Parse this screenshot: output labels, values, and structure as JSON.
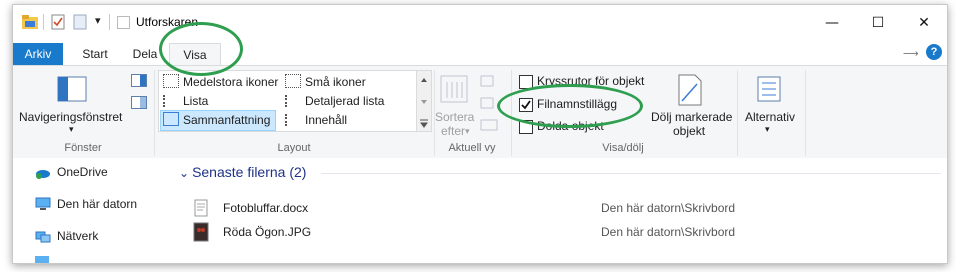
{
  "window": {
    "title": "Utforskaren"
  },
  "qat": {
    "dropdown": "▾"
  },
  "controls": {
    "minimize": "—",
    "maximize": "☐",
    "close": "✕"
  },
  "tabs": {
    "file": "Arkiv",
    "start": "Start",
    "share": "Dela",
    "view": "Visa"
  },
  "ribbon_right": {
    "pin": "⟶",
    "help": "?"
  },
  "ribbon": {
    "panes": {
      "nav_pane_line1": "Navigeringsfönstret",
      "nav_pane_arrow": "▾",
      "group": "Fönster"
    },
    "layout": {
      "items": [
        "Medelstora ikoner",
        "Små ikoner",
        "Lista",
        "Detaljerad lista",
        "Sammanfattning",
        "Innehåll"
      ],
      "selected": "Sammanfattning",
      "group": "Layout"
    },
    "current_view": {
      "sort_line1": "Sortera",
      "sort_line2": "efter",
      "sort_arrow": "▾",
      "group": "Aktuell vy"
    },
    "show_hide": {
      "item_checkboxes": "Kryssrutor för objekt",
      "file_extensions": "Filnamnstillägg",
      "hidden_items": "Dolda objekt",
      "hide_selected_line1": "Dölj markerade",
      "hide_selected_line2": "objekt",
      "group": "Visa/dölj",
      "checked": {
        "item_checkboxes": false,
        "file_extensions": true,
        "hidden_items": false
      }
    },
    "options": {
      "label": "Alternativ",
      "arrow": "▾"
    }
  },
  "nav": {
    "items": [
      "OneDrive",
      "Den här datorn",
      "Nätverk"
    ]
  },
  "content": {
    "group_header": "Senaste filerna (2)",
    "chevron": "⌄",
    "files": [
      {
        "name": "Fotobluffar.docx",
        "location": "Den här datorn\\Skrivbord"
      },
      {
        "name": "Röda Ögon.JPG",
        "location": "Den här datorn\\Skrivbord"
      }
    ]
  },
  "colors": {
    "accent": "#1979ca",
    "highlight_ring": "#2e9e4f",
    "selection": "#cce8ff"
  }
}
